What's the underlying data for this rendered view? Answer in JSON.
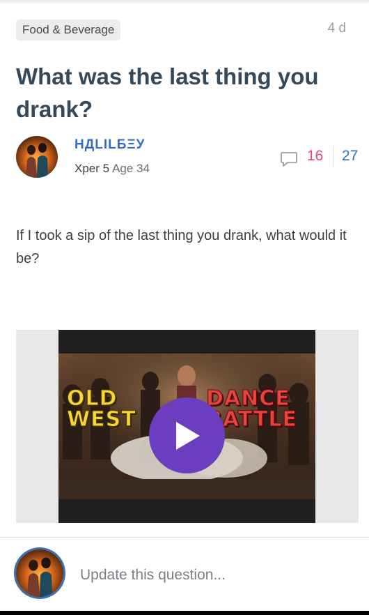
{
  "question": {
    "category": "Food & Beverage",
    "time_ago": "4 d",
    "title": "What was the last thing you drank?",
    "body": "If I took a sip of the last thing you drank, what would it be?"
  },
  "author": {
    "name": "НДLILБΞУ",
    "level": "Xper 5",
    "age": "Age 34"
  },
  "stats": {
    "opinions": "16",
    "views": "27",
    "comment_icon": "comment-bubble-icon"
  },
  "video": {
    "thumbnail_text_left": [
      "OLD",
      "WEST"
    ],
    "thumbnail_text_right": [
      "DANCE",
      "BATTLE"
    ],
    "play_icon": "play-icon"
  },
  "footer": {
    "update_placeholder": "Update this question..."
  },
  "colors": {
    "title": "#34495a",
    "author_name": "#2f6ec8",
    "opinions": "#e0457b",
    "views": "#2f6ec8",
    "play_button": "#6a3ebf"
  }
}
